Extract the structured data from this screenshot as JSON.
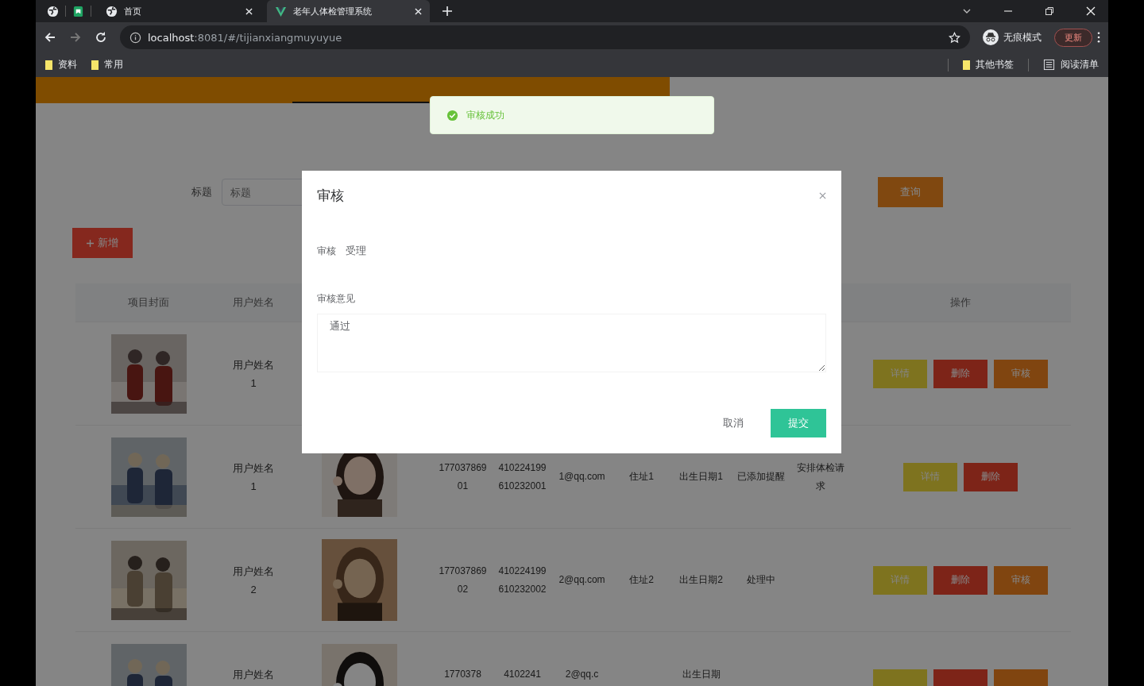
{
  "browser": {
    "tabs": [
      {
        "title": "首页",
        "selected": false
      },
      {
        "title": "老年人体检管理系统",
        "selected": true
      }
    ],
    "address_host": "localhost",
    "address_path": ":8081/#/tijianxiangmuyuyue",
    "profile": "无痕模式",
    "update": "更新",
    "bookmarks": [
      "资料",
      "常用"
    ],
    "other_bookmarks": "其他书签",
    "reading_list": "阅读清单"
  },
  "toast": {
    "message": "审核成功"
  },
  "search": {
    "label": "标题",
    "placeholder": "标题",
    "button": "查询"
  },
  "add_button": "新增",
  "table": {
    "columns": [
      {
        "label": "项目封面"
      },
      {
        "label": "用户姓名"
      },
      {},
      {},
      {},
      {},
      {},
      {},
      {},
      {},
      {
        "label": "操作"
      }
    ],
    "rows": [
      {
        "user_name": "用户姓名1",
        "actions": [
          {
            "kind": "detail",
            "label": "详情"
          },
          {
            "kind": "delete",
            "label": "删除"
          },
          {
            "kind": "review",
            "label": "审核"
          }
        ]
      },
      {
        "user_name": "用户姓名1",
        "avatar": true,
        "phone": "17703786901",
        "id_number": "410224199610232001",
        "email": "1@qq.com",
        "address": "住址1",
        "birth": "出生日期1",
        "status": "已添加提醒",
        "note": "安排体检请求",
        "actions": [
          {
            "kind": "detail",
            "label": "详情"
          },
          {
            "kind": "delete",
            "label": "删除"
          }
        ]
      },
      {
        "user_name": "用户姓名2",
        "avatar": true,
        "phone": "17703786902",
        "id_number": "410224199610232002",
        "email": "2@qq.com",
        "address": "住址2",
        "birth": "出生日期2",
        "status": "处理中",
        "actions": [
          {
            "kind": "detail",
            "label": "详情"
          },
          {
            "kind": "delete",
            "label": "删除"
          },
          {
            "kind": "review",
            "label": "审核"
          }
        ]
      },
      {
        "user_name": "用户姓名",
        "avatar": true,
        "phone": "1770378",
        "id_number": "4102241",
        "email": "2@qq.c",
        "birth": "出生日期",
        "actions": [
          {
            "kind": "detail"
          },
          {
            "kind": "delete"
          },
          {
            "kind": "review"
          }
        ]
      }
    ]
  },
  "dialog": {
    "title": "审核",
    "review_label": "审核",
    "review_value": "受理",
    "opinion_label": "审核意见",
    "opinion_value": "通过",
    "cancel": "取消",
    "submit": "提交"
  }
}
